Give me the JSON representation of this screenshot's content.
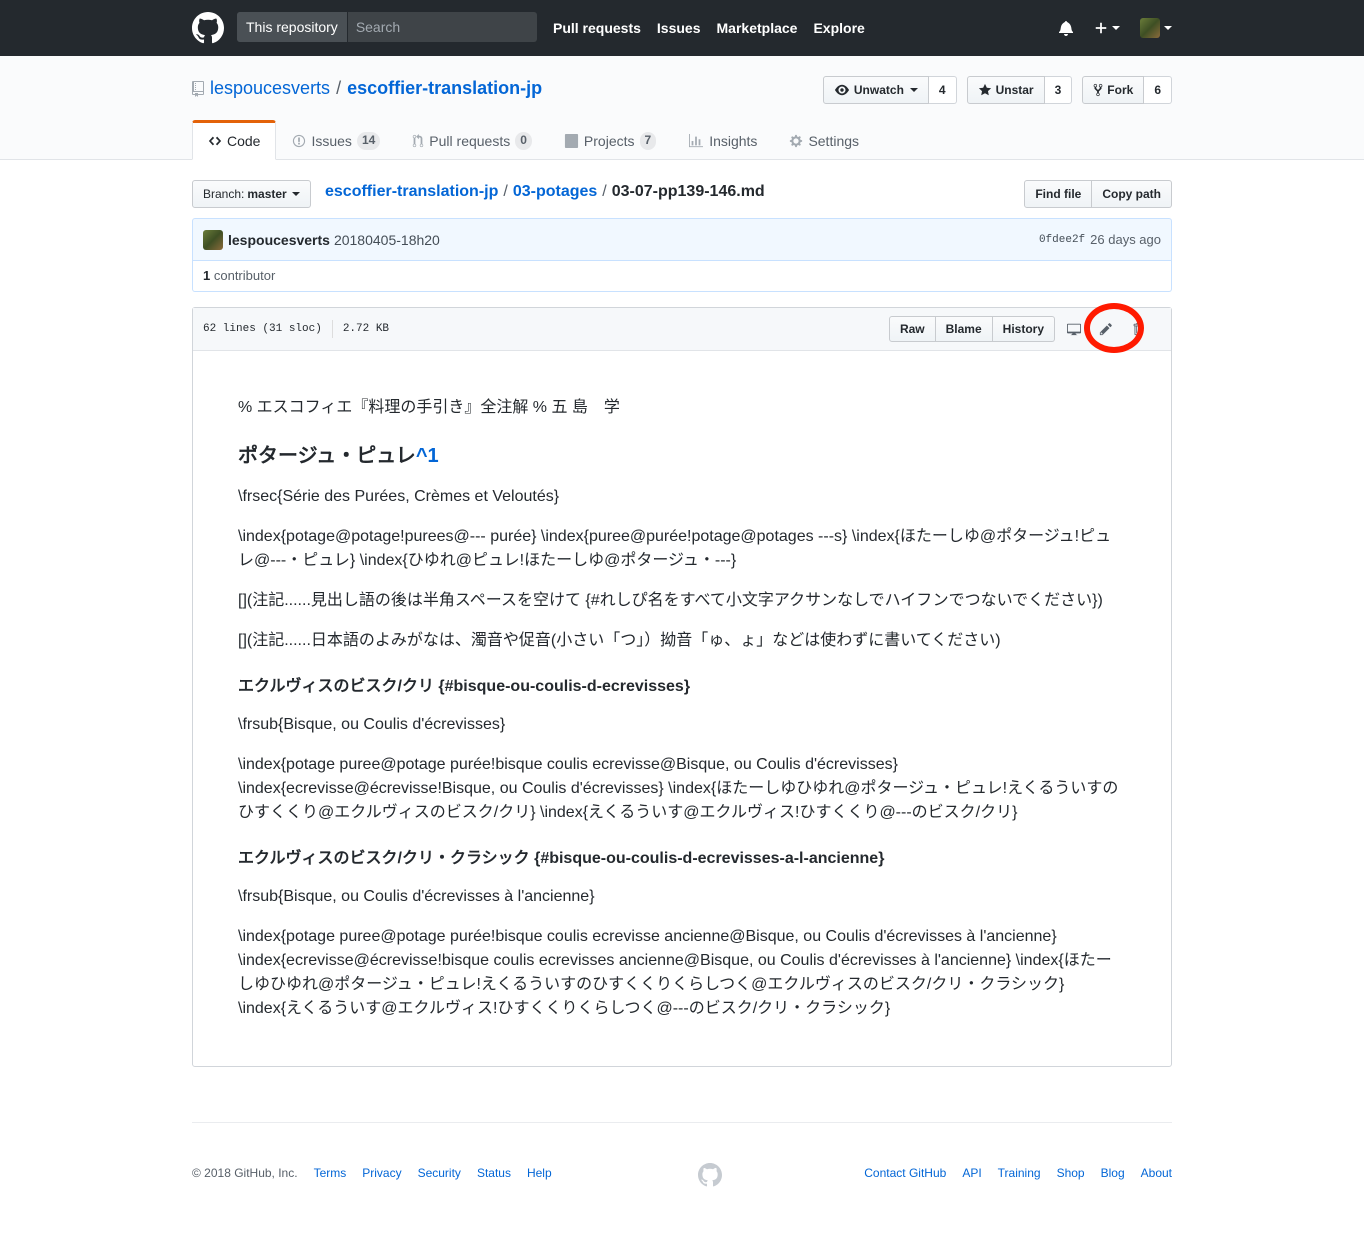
{
  "header": {
    "scope_label": "This repository",
    "search_placeholder": "Search",
    "nav": [
      "Pull requests",
      "Issues",
      "Marketplace",
      "Explore"
    ]
  },
  "repo": {
    "owner": "lespoucesverts",
    "name": "escoffier-translation-jp",
    "watch": {
      "label": "Unwatch",
      "count": "4"
    },
    "star": {
      "label": "Unstar",
      "count": "3"
    },
    "fork": {
      "label": "Fork",
      "count": "6"
    },
    "tabs": {
      "code": {
        "label": "Code"
      },
      "issues": {
        "label": "Issues",
        "count": "14"
      },
      "pulls": {
        "label": "Pull requests",
        "count": "0"
      },
      "projects": {
        "label": "Projects",
        "count": "7"
      },
      "insights": {
        "label": "Insights"
      },
      "settings": {
        "label": "Settings"
      }
    }
  },
  "file_nav": {
    "branch_prefix": "Branch:",
    "branch": "master",
    "crumb_root": "escoffier-translation-jp",
    "crumb_dir": "03-potages",
    "crumb_file": "03-07-pp139-146.md",
    "find_file": "Find file",
    "copy_path": "Copy path"
  },
  "commit": {
    "author": "lespoucesverts",
    "message": "20180405-18h20",
    "sha": "0fdee2f",
    "age": "26 days ago",
    "contributors_count": "1",
    "contributors_label": "contributor"
  },
  "file": {
    "lines": "62 lines (31 sloc)",
    "size": "2.72 KB",
    "raw": "Raw",
    "blame": "Blame",
    "history": "History"
  },
  "content": {
    "p1": "% エスコフィエ『料理の手引き』全注解 % 五 島　学",
    "h2": "ポタージュ・ピュレ",
    "h2_link": "^1",
    "p2": "\\frsec{Série des Purées, Crèmes et Veloutés}",
    "p3": "\\index{potage@potage!purees@--- purée} \\index{puree@purée!potage@potages ---s} \\index{ほたーしゆ@ポタージュ!ピュレ@---・ピュレ} \\index{ひゆれ@ピュレ!ほたーしゆ@ポタージュ・---}",
    "p4": "[](注記......見出し語の後は半角スペースを空けて {#れしぴ名をすべて小文字アクサンなしでハイフンでつないでください})",
    "p5": "[](注記......日本語のよみがなは、濁音や促音(小さい「つ」）拗音「ゅ、ょ」などは使わずに書いてください)",
    "h3a": "エクルヴィスのビスク/クリ {#bisque-ou-coulis-d-ecrevisses}",
    "p6": "\\frsub{Bisque, ou Coulis d'écrevisses}",
    "p7": "\\index{potage puree@potage purée!bisque coulis ecrevisse@Bisque, ou Coulis d'écrevisses} \\index{ecrevisse@écrevisse!Bisque, ou Coulis d'écrevisses} \\index{ほたーしゆひゆれ@ポタージュ・ピュレ!えくるういすのひすくくり@エクルヴィスのビスク/クリ} \\index{えくるういす@エクルヴィス!ひすくくり@---のビスク/クリ}",
    "h3b": "エクルヴィスのビスク/クリ・クラシック {#bisque-ou-coulis-d-ecrevisses-a-l-ancienne}",
    "p8": "\\frsub{Bisque, ou Coulis d'écrevisses à l'ancienne}",
    "p9": "\\index{potage puree@potage purée!bisque coulis ecrevisse ancienne@Bisque, ou Coulis d'écrevisses à l'ancienne} \\index{ecrevisse@écrevisse!bisque coulis ecrevisses ancienne@Bisque, ou Coulis d'écrevisses à l'ancienne} \\index{ほたーしゆひゆれ@ポタージュ・ピュレ!えくるういすのひすくくりくらしつく@エクルヴィスのビスク/クリ・クラシック} \\index{えくるういす@エクルヴィス!ひすくくりくらしつく@---のビスク/クリ・クラシック}"
  },
  "footer": {
    "copyright": "© 2018 GitHub, Inc.",
    "left_links": [
      "Terms",
      "Privacy",
      "Security",
      "Status",
      "Help"
    ],
    "right_links": [
      "Contact GitHub",
      "API",
      "Training",
      "Shop",
      "Blog",
      "About"
    ]
  },
  "colors": {
    "header_bg": "#24292e",
    "link": "#0366d6",
    "highlight": "#ff1a00",
    "tab_accent": "#e36209"
  }
}
